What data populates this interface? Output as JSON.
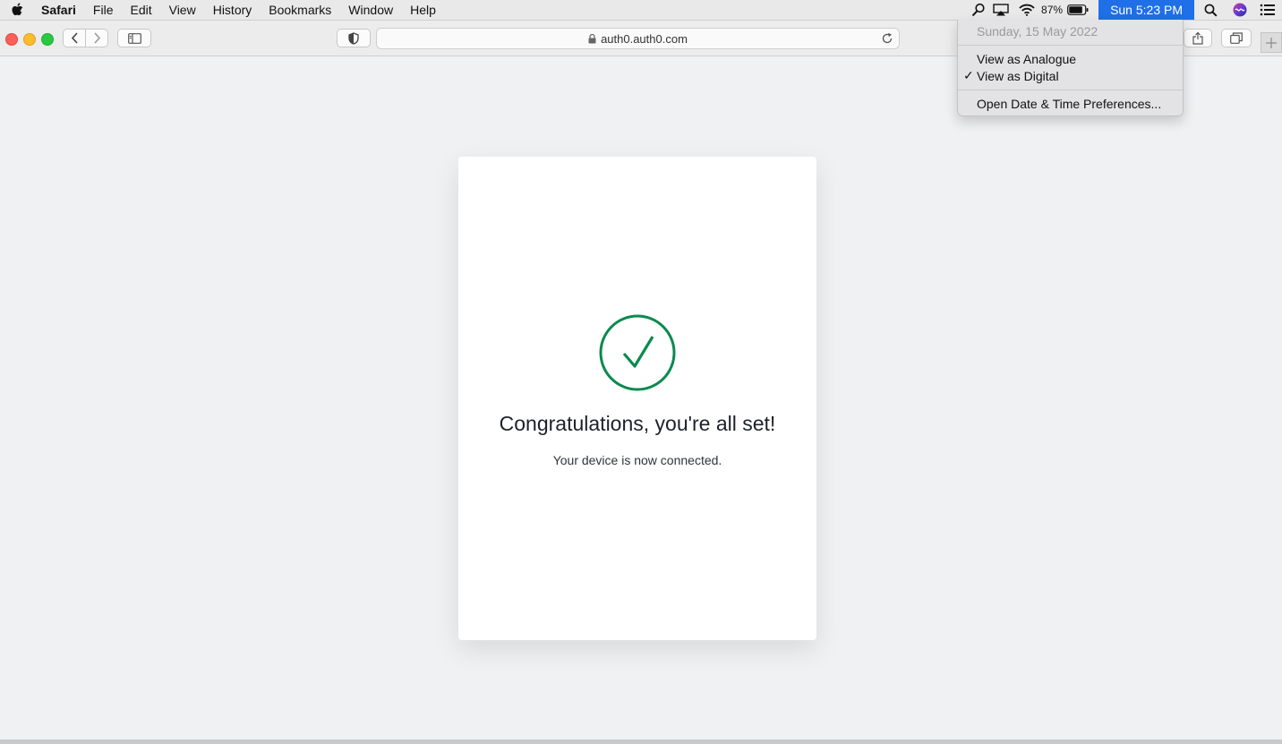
{
  "menubar": {
    "app_name": "Safari",
    "items": [
      "File",
      "Edit",
      "View",
      "History",
      "Bookmarks",
      "Window",
      "Help"
    ],
    "battery_percent": "87%",
    "clock": "Sun 5:23 PM",
    "icons": [
      "apple-icon",
      "magnifier-status-icon",
      "airplay-icon",
      "wifi-icon",
      "battery-icon",
      "spotlight-icon",
      "siri-icon",
      "control-list-icon"
    ]
  },
  "toolbar": {
    "url": "auth0.auth0.com"
  },
  "page": {
    "title": "Congratulations, you're all set!",
    "subtitle": "Your device is now connected.",
    "accent_color": "#0a8a4f"
  },
  "clock_menu": {
    "date": "Sunday, 15 May 2022",
    "options": [
      "View as Analogue",
      "View as Digital"
    ],
    "selected": "View as Digital",
    "preferences": "Open Date & Time Preferences..."
  }
}
